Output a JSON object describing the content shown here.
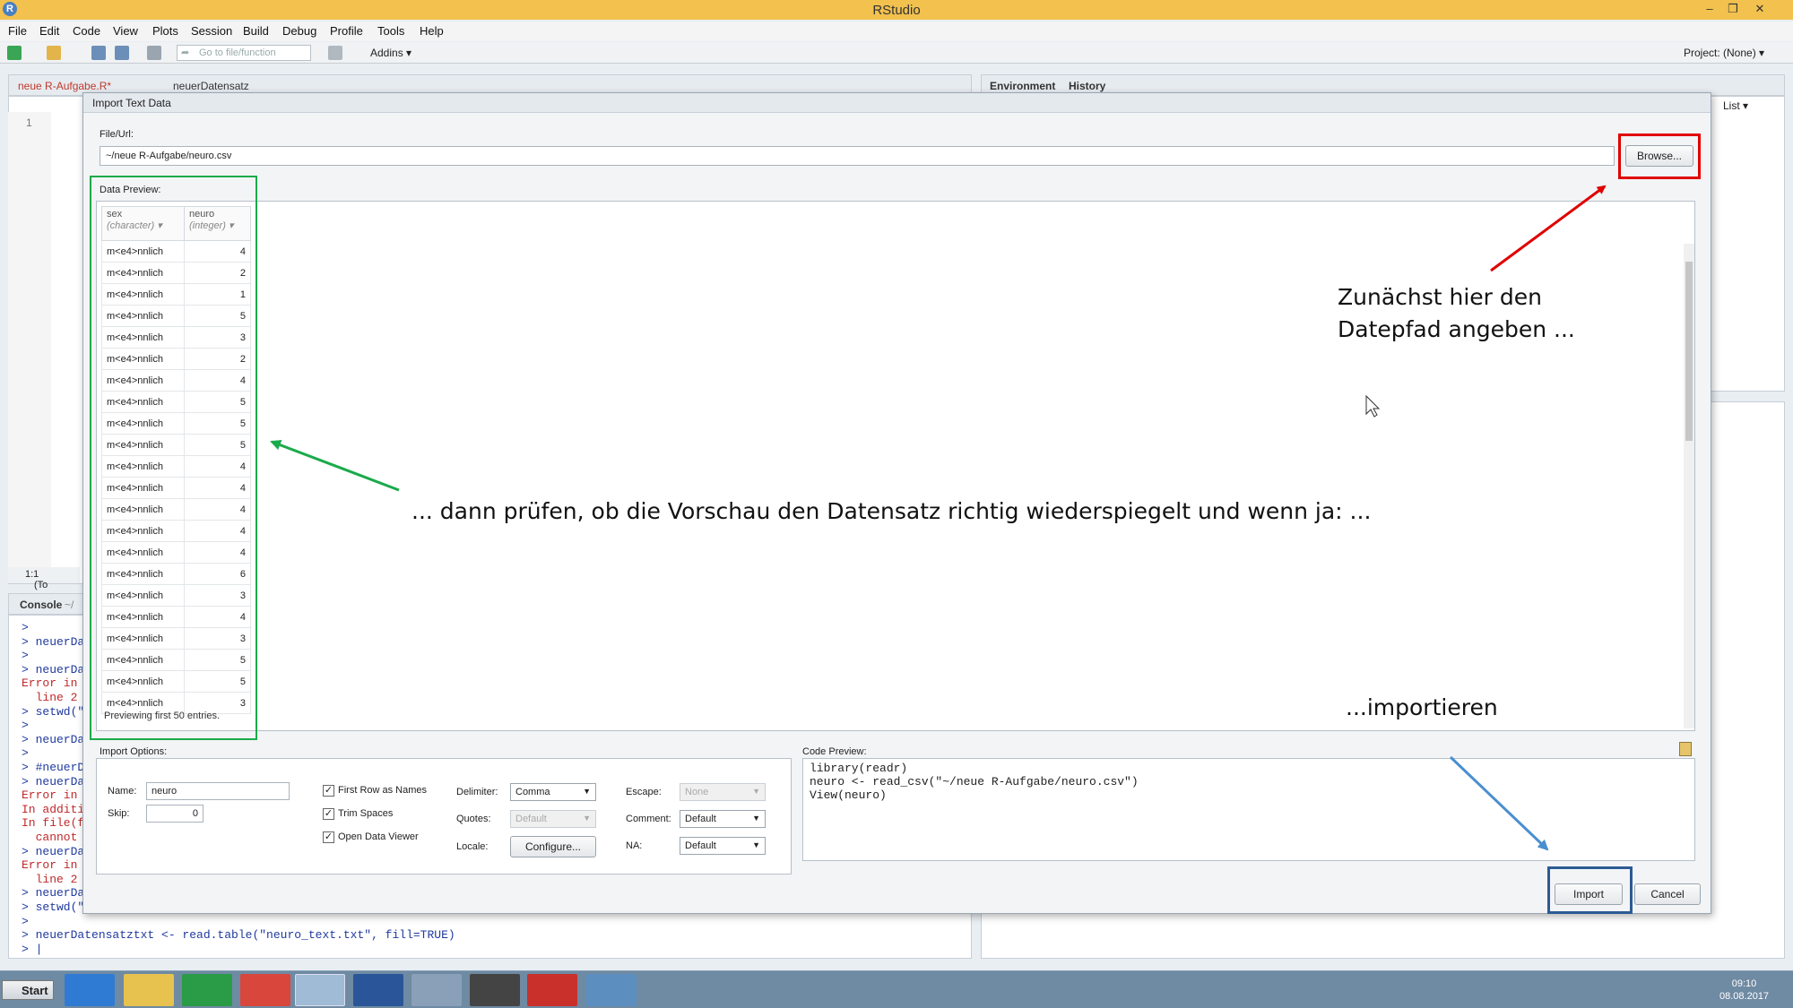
{
  "window": {
    "title": "RStudio"
  },
  "menu": [
    "File",
    "Edit",
    "Code",
    "View",
    "Plots",
    "Session",
    "Build",
    "Debug",
    "Profile",
    "Tools",
    "Help"
  ],
  "toolbar": {
    "goto_placeholder": "Go to file/function",
    "addins": "Addins",
    "project": "Project: (None)"
  },
  "editor": {
    "tabs": [
      "neue R-Aufgabe.R*",
      "neuerDatensatz"
    ],
    "line_number": "1",
    "status_pos": "1:1",
    "status_scope": "(To"
  },
  "env": {
    "tabs": [
      "Environment",
      "History"
    ],
    "list_label": "List"
  },
  "console": {
    "tab": "Console",
    "path": "~/",
    "lines": [
      {
        "text": ">",
        "err": false
      },
      {
        "text": "> neuerDa",
        "err": false
      },
      {
        "text": ">",
        "err": false
      },
      {
        "text": "> neuerDa",
        "err": false
      },
      {
        "text": "Error in",
        "err": true
      },
      {
        "text": "  line 2",
        "err": true
      },
      {
        "text": "> setwd(\"",
        "err": false
      },
      {
        "text": ">",
        "err": false
      },
      {
        "text": "> neuerDa",
        "err": false
      },
      {
        "text": ">",
        "err": false
      },
      {
        "text": "> #neuerD",
        "err": false
      },
      {
        "text": "> neuerDa",
        "err": false
      },
      {
        "text": "Error in",
        "err": true
      },
      {
        "text": "In additi",
        "err": true
      },
      {
        "text": "In file(f",
        "err": true
      },
      {
        "text": "  cannot",
        "err": true
      },
      {
        "text": "> neuerDa",
        "err": false
      },
      {
        "text": "Error in",
        "err": true
      },
      {
        "text": "  line 2",
        "err": true
      },
      {
        "text": "> neuerDa",
        "err": false
      },
      {
        "text": "> setwd(\"",
        "err": false
      },
      {
        "text": ">",
        "err": false
      },
      {
        "text": "> neuerDatensatztxt <- read.table(\"neuro_text.txt\", fill=TRUE)",
        "err": false
      },
      {
        "text": "> |",
        "err": false
      }
    ]
  },
  "dialog": {
    "title": "Import Text Data",
    "file_label": "File/Url:",
    "file_value": "~/neue R-Aufgabe/neuro.csv",
    "browse": "Browse...",
    "preview_label": "Data Preview:",
    "columns": [
      {
        "name": "sex",
        "type": "(character)"
      },
      {
        "name": "neuro",
        "type": "(integer)"
      }
    ],
    "rows": [
      [
        "m<e4>nnlich",
        "4"
      ],
      [
        "m<e4>nnlich",
        "2"
      ],
      [
        "m<e4>nnlich",
        "1"
      ],
      [
        "m<e4>nnlich",
        "5"
      ],
      [
        "m<e4>nnlich",
        "3"
      ],
      [
        "m<e4>nnlich",
        "2"
      ],
      [
        "m<e4>nnlich",
        "4"
      ],
      [
        "m<e4>nnlich",
        "5"
      ],
      [
        "m<e4>nnlich",
        "5"
      ],
      [
        "m<e4>nnlich",
        "5"
      ],
      [
        "m<e4>nnlich",
        "4"
      ],
      [
        "m<e4>nnlich",
        "4"
      ],
      [
        "m<e4>nnlich",
        "4"
      ],
      [
        "m<e4>nnlich",
        "4"
      ],
      [
        "m<e4>nnlich",
        "4"
      ],
      [
        "m<e4>nnlich",
        "6"
      ],
      [
        "m<e4>nnlich",
        "3"
      ],
      [
        "m<e4>nnlich",
        "4"
      ],
      [
        "m<e4>nnlich",
        "3"
      ],
      [
        "m<e4>nnlich",
        "5"
      ],
      [
        "m<e4>nnlich",
        "5"
      ],
      [
        "m<e4>nnlich",
        "3"
      ]
    ],
    "preview_note": "Previewing first 50 entries.",
    "import_options_label": "Import Options:",
    "name_label": "Name:",
    "name_value": "neuro",
    "skip_label": "Skip:",
    "skip_value": "0",
    "first_row_names": "First Row as Names",
    "trim_spaces": "Trim Spaces",
    "open_viewer": "Open Data Viewer",
    "delimiter_label": "Delimiter:",
    "delimiter_value": "Comma",
    "quotes_label": "Quotes:",
    "quotes_value": "Default",
    "locale_label": "Locale:",
    "locale_button": "Configure...",
    "escape_label": "Escape:",
    "escape_value": "None",
    "comment_label": "Comment:",
    "comment_value": "Default",
    "na_label": "NA:",
    "na_value": "Default",
    "code_label": "Code Preview:",
    "code_lines": [
      "library(readr)",
      "neuro <- read_csv(\"~/neue R-Aufgabe/neuro.csv\")",
      "View(neuro)"
    ],
    "import_button": "Import",
    "cancel_button": "Cancel"
  },
  "annotations": {
    "step1_line1": "Zunächst hier den",
    "step1_line2": "Datepfad angeben ...",
    "step2": "... dann prüfen, ob die Vorschau den Datensatz richtig wiederspiegelt und wenn ja: ...",
    "step3": "...importieren"
  },
  "taskbar": {
    "start": "Start",
    "time": "09:10",
    "date": "08.08.2017"
  },
  "colors": {
    "titlebar": "#f2c14e",
    "highlight_red": "#e00000",
    "highlight_green": "#1aaa4a",
    "highlight_blue": "#2c5b94",
    "arrow_blue": "#4a8fd0"
  }
}
